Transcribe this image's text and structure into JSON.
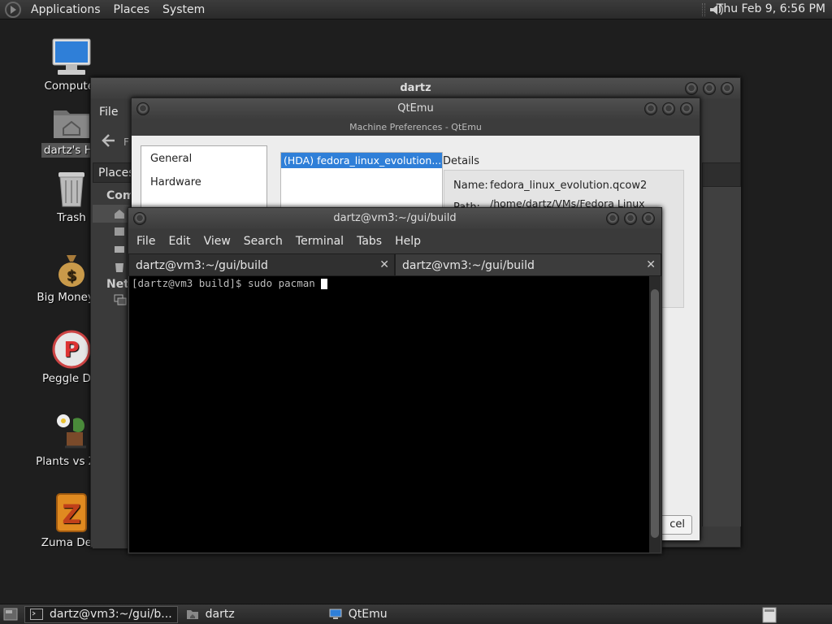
{
  "top_panel": {
    "menus": [
      "Applications",
      "Places",
      "System"
    ],
    "clock": "Thu Feb  9,  6:56 PM"
  },
  "desktop": {
    "icons": [
      {
        "label": "Computer",
        "icon": "computer-icon"
      },
      {
        "label": "dartz's Ho",
        "icon": "home-folder-icon"
      },
      {
        "label": "Trash",
        "icon": "trash-icon"
      },
      {
        "label": "Big Money D",
        "icon": "money-bag-icon"
      },
      {
        "label": "Peggle Del",
        "icon": "peggle-icon"
      },
      {
        "label": "Plants vs Zor",
        "icon": "plants-vs-zombies-icon"
      },
      {
        "label": "Zuma Delu",
        "icon": "zuma-icon"
      }
    ]
  },
  "nautilus": {
    "title": "dartz",
    "menu_file": "File",
    "sidebar_header": "Places",
    "sidebar_computer": "Comp",
    "sidebar_network": "Netw",
    "pathbar_char": "F"
  },
  "qtemu": {
    "title": "QtEmu",
    "subtitle": "Machine Preferences - QtEmu",
    "nav": [
      "General",
      "Hardware"
    ],
    "drive_item": "(HDA) fedora_linux_evolution....",
    "details_header": "Details",
    "name_label": "Name:",
    "name_value": "fedora_linux_evolution.qcow2",
    "path_label": "Path:",
    "path_value": "/home/dartz/VMs/Fedora Linux",
    "cancel_partial": "cel"
  },
  "terminal": {
    "title": "dartz@vm3:~/gui/build",
    "menus": [
      "File",
      "Edit",
      "View",
      "Search",
      "Terminal",
      "Tabs",
      "Help"
    ],
    "tabs": [
      {
        "label": "dartz@vm3:~/gui/build",
        "close": "✕"
      },
      {
        "label": "dartz@vm3:~/gui/build",
        "close": "✕"
      }
    ],
    "prompt": "[dartz@vm3 build]$ sudo pacman "
  },
  "taskbar": {
    "tasks": [
      {
        "label": "dartz@vm3:~/gui/b...",
        "icon": "terminal-icon"
      },
      {
        "label": "dartz",
        "icon": "folder-icon"
      },
      {
        "label": "QtEmu",
        "icon": "qtemu-icon"
      }
    ]
  },
  "colors": {
    "desktop_bg": "#1e1e1e",
    "panel": "#333333",
    "selection": "#2f7fd8",
    "terminal_bg": "#000000"
  }
}
